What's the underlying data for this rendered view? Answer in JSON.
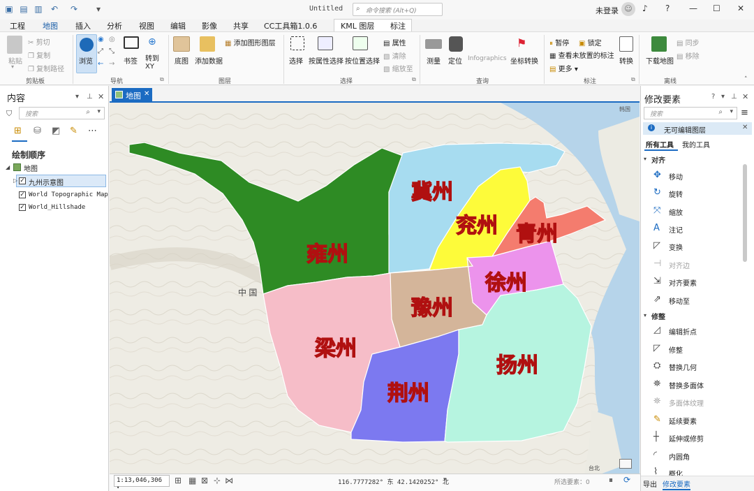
{
  "titlebar": {
    "doc_title": "Untitled",
    "command_search_placeholder": "命令搜索 (Alt+Q)",
    "user": "未登录",
    "help": "?"
  },
  "tabs": [
    "工程",
    "地图",
    "插入",
    "分析",
    "视图",
    "编辑",
    "影像",
    "共享",
    "CC工具箱1.0.6",
    "KML 图层",
    "标注"
  ],
  "active_tab": "地图",
  "ribbon": {
    "clipboard": {
      "paste": "粘贴",
      "cut": "剪切",
      "copy": "复制",
      "copy_path": "复制路径",
      "group": "剪贴板"
    },
    "navigate": {
      "explore": "浏览",
      "bookmarks": "书签",
      "goto_xy": "转到 XY",
      "group": "导航"
    },
    "layer": {
      "basemap": "底图",
      "add_data": "添加数据",
      "add_graphics_layer": "添加图形图层",
      "group": "图层"
    },
    "selection": {
      "select": "选择",
      "select_by_attr": "按属性选择",
      "select_by_loc": "按位置选择",
      "attributes": "属性",
      "clear": "清除",
      "zoom_to": "缩放至",
      "group": "选择"
    },
    "inquiry": {
      "measure": "测量",
      "locate": "定位",
      "infographics": "Infographics",
      "convert_coords": "坐标转换",
      "group": "查询"
    },
    "labeling": {
      "pause": "暂停",
      "lock": "锁定",
      "view_unplaced": "查看未放置的标注",
      "more": "更多",
      "convert": "转换",
      "group": "标注"
    },
    "offline": {
      "download_map": "下载地图",
      "sync": "同步",
      "remove": "移除",
      "group": "离线"
    }
  },
  "contents": {
    "title": "内容",
    "search_placeholder": "搜索",
    "draw_order": "绘制顺序",
    "map": "地图",
    "layers": [
      "九州示意图",
      "World Topographic Map",
      "World_Hillshade"
    ]
  },
  "map_tab": "地图",
  "map": {
    "regions": [
      {
        "name": "雍州",
        "color": "#2e8b24"
      },
      {
        "name": "冀州",
        "color": "#a7dcf0"
      },
      {
        "name": "兖州",
        "color": "#fdfb3a"
      },
      {
        "name": "青州",
        "color": "#f47c6e"
      },
      {
        "name": "徐州",
        "color": "#ec93ec"
      },
      {
        "name": "豫州",
        "color": "#d4b59a"
      },
      {
        "name": "梁州",
        "color": "#f6bdc8"
      },
      {
        "name": "荆州",
        "color": "#7c79f0"
      },
      {
        "name": "扬州",
        "color": "#b6f4e0"
      }
    ],
    "country_label": "中 国",
    "corner_label": "韩国",
    "taiwan_label": "台北"
  },
  "statusbar": {
    "scale": "1:13,046,306",
    "coords": "116.7777282° 东 42.1420252° 北",
    "selected": "所选要素：0"
  },
  "modify": {
    "title": "修改要素",
    "search_placeholder": "搜索",
    "info": "无可编辑图层",
    "tab_all": "所有工具",
    "tab_mine": "我的工具",
    "sections": [
      "对齐",
      "修整"
    ],
    "align_tools": [
      "移动",
      "旋转",
      "缩放",
      "注记",
      "变换",
      "对齐边",
      "对齐要素",
      "移动至"
    ],
    "reshape_tools": [
      "编辑折点",
      "修整",
      "替换几何",
      "替换多面体",
      "多面体纹理",
      "延续要素",
      "延伸或修剪",
      "内圆角",
      "概化"
    ],
    "footer": [
      "导出",
      "修改要素"
    ]
  }
}
